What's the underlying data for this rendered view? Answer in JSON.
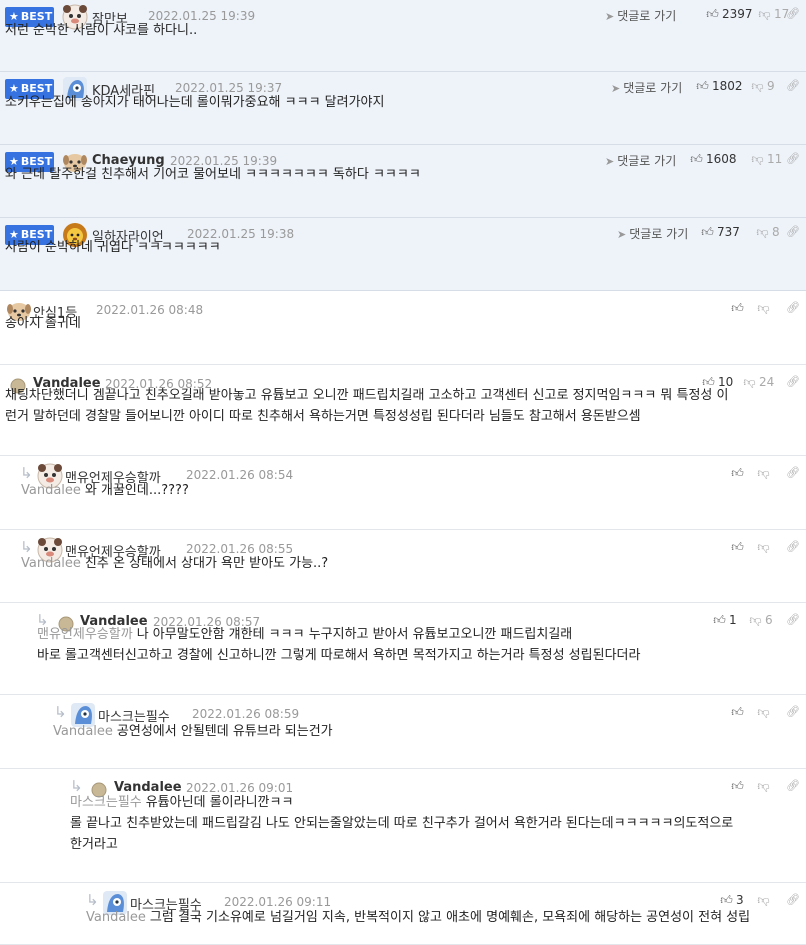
{
  "best_label": "BEST",
  "goto_label": "댓글로 가기",
  "comments": [
    {
      "nick": "잠만보",
      "date": "2022.01.25 19:39",
      "likes": "2397",
      "dislikes": "17",
      "text": "저런 순박한 사람이 샤코를 하다니.."
    },
    {
      "nick": "KDA세라핀",
      "date": "2022.01.25 19:37",
      "likes": "1802",
      "dislikes": "9",
      "text": "소키우는집에 송아지가 태어나는데 롤이뭐가중요해 ㅋㅋㅋ 달려가야지"
    },
    {
      "nick": "Chaeyung",
      "date": "2022.01.25 19:39",
      "likes": "1608",
      "dislikes": "11",
      "text": "와 근데 탈주한걸 친추해서 기어코 물어보네 ㅋㅋㅋㅋㅋㅋㅋ 독하다 ㅋㅋㅋㅋ"
    },
    {
      "nick": "일하자라이언",
      "date": "2022.01.25 19:38",
      "likes": "737",
      "dislikes": "8",
      "text": "사람이 순박하네 귀엽다 ㅋㅋㅋㅋㅋㅋㅋ"
    },
    {
      "nick": "안심1등",
      "date": "2022.01.26 08:48",
      "likes": "",
      "dislikes": "",
      "text": "송아지 졸귀네"
    },
    {
      "nick": "Vandalee",
      "date": "2022.01.26 08:52",
      "likes": "10",
      "dislikes": "24",
      "text1": "채팅차단했더니 겜끝나고 친추오길래 받아놓고 유튭보고 오니깐 패드립치길래 고소하고 고객센터 신고로 정지먹임ㅋㅋㅋ 뭐 특정성 이",
      "text2": "런거 말하던데 경찰말 들어보니깐 아이디 따로 친추해서 욕하는거면 특정성성립 된다더라 님들도 참고해서 용돈받으셈"
    },
    {
      "nick": "맨유언제우승할까",
      "date": "2022.01.26 08:54",
      "likes": "",
      "dislikes": "",
      "mention": "Vandalee",
      "text": "와 개꿀인데...????"
    },
    {
      "nick": "맨유언제우승할까",
      "date": "2022.01.26 08:55",
      "likes": "",
      "dislikes": "",
      "mention": "Vandalee",
      "text": "친추 온 상태에서 상대가 욕만 받아도 가능..?"
    },
    {
      "nick": "Vandalee",
      "date": "2022.01.26 08:57",
      "likes": "1",
      "dislikes": "6",
      "mention": "맨유언제우승할까",
      "text1": "나 아무말도안함 걔한테 ㅋㅋㅋ 누구지하고 받아서 유튭보고오니깐 패드립치길래",
      "text2": "바로 롤고객센터신고하고 경찰에 신고하니깐 그렇게 따로해서 욕하면 목적가지고 하는거라 특정성 성립된다더라"
    },
    {
      "nick": "마스크는필수",
      "date": "2022.01.26 08:59",
      "likes": "",
      "dislikes": "",
      "mention": "Vandalee",
      "text": "공연성에서 안될텐데 유튜브라 되는건가"
    },
    {
      "nick": "Vandalee",
      "date": "2022.01.26 09:01",
      "likes": "",
      "dislikes": "",
      "mention": "마스크는필수",
      "text1": "유튭아닌데 롤이라니깐ㅋㅋ",
      "text2": "롤 끝나고 친추받았는데 패드립갈김 나도 안되는줄알았는데 따로 친구추가 걸어서 욕한거라 된다는데ㅋㅋㅋㅋㅋ의도적으로",
      "text3": "한거라고"
    },
    {
      "nick": "마스크는필수",
      "date": "2022.01.26 09:11",
      "likes": "3",
      "dislikes": "",
      "mention": "Vandalee",
      "text": "그럼 결국 기소유예로 넘길거임 지속, 반복적이지 않고 애초에 명예훼손, 모욕죄에 해당하는 공연성이 전혀 성립"
    }
  ],
  "icons": {
    "like": "thumbs-up-icon",
    "dislike": "thumbs-down-icon",
    "link": "link-icon",
    "goto": "paper-plane-icon",
    "reply": "reply-arrow-icon",
    "star": "star-icon"
  },
  "colors": {
    "best_badge": "#3673e0",
    "best_bg": "#eef3fa"
  }
}
